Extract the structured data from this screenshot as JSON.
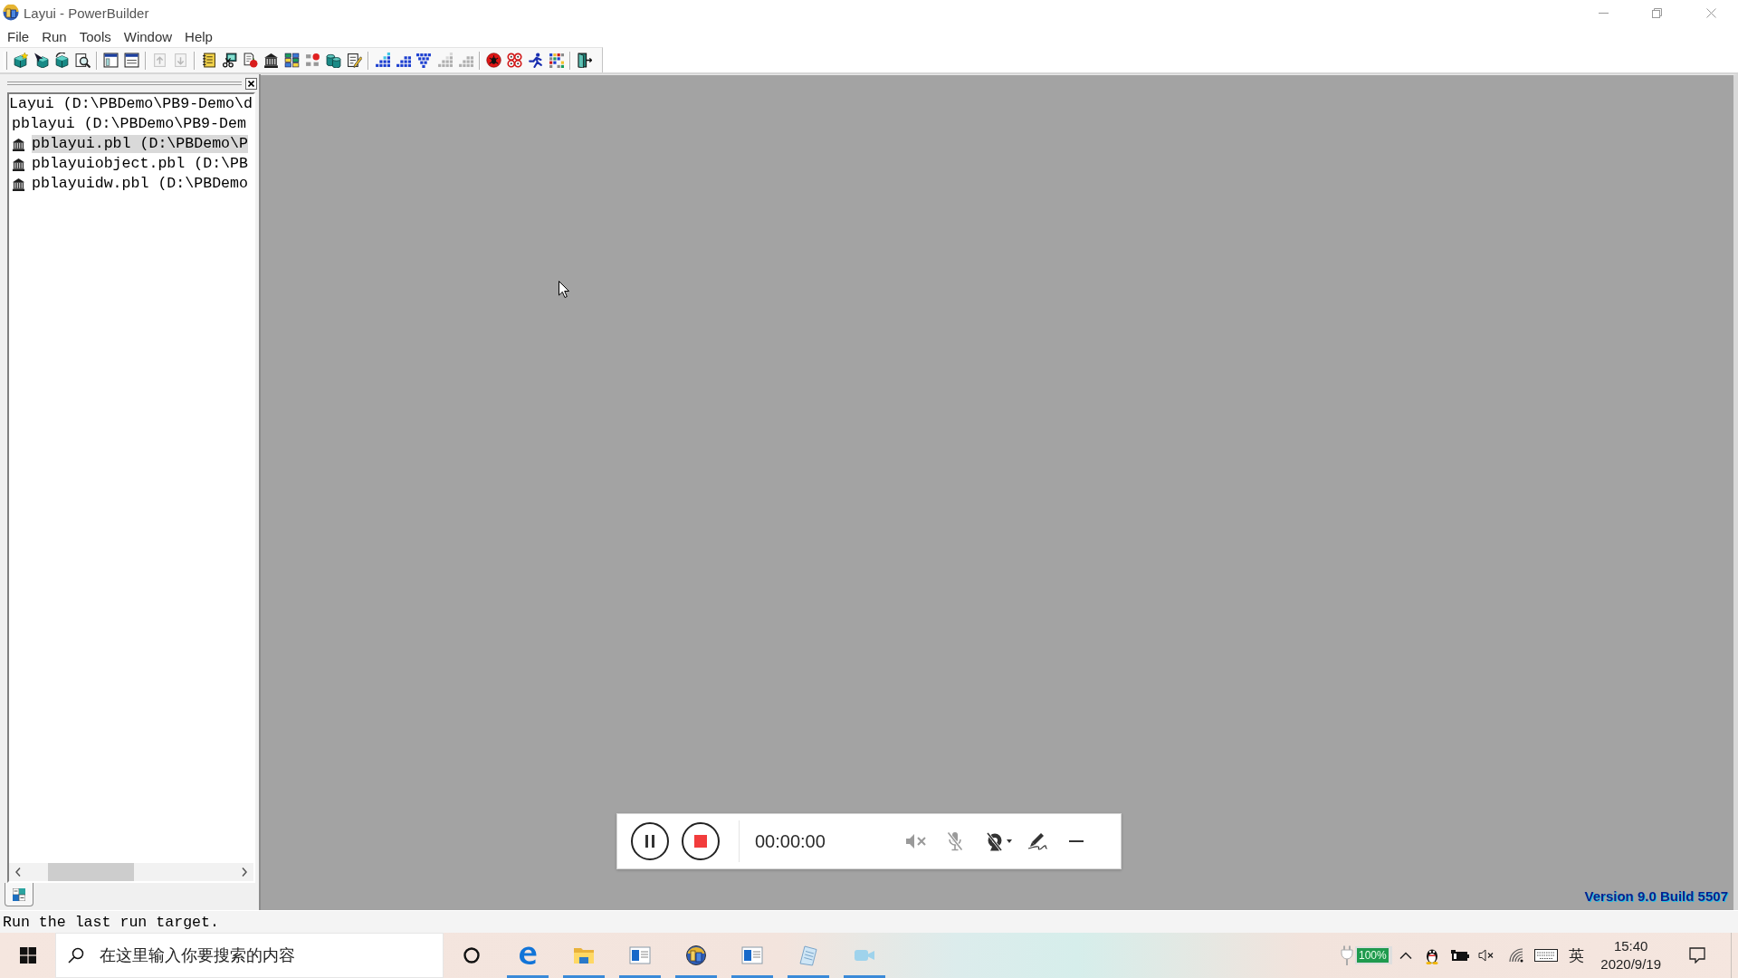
{
  "window": {
    "title": "Layui - PowerBuilder"
  },
  "menu": [
    "File",
    "Run",
    "Tools",
    "Window",
    "Help"
  ],
  "toolbar": [
    [
      {
        "kind": "cubestar",
        "disabled": false
      },
      {
        "kind": "cubearrow",
        "disabled": false
      },
      {
        "kind": "cube",
        "disabled": false
      },
      {
        "kind": "magnifier",
        "disabled": false
      }
    ],
    [
      {
        "kind": "panes",
        "disabled": false
      },
      {
        "kind": "lines",
        "disabled": false
      }
    ],
    [
      {
        "kind": "docup",
        "disabled": true
      },
      {
        "kind": "docdown",
        "disabled": true
      }
    ],
    [
      {
        "kind": "notebook",
        "disabled": false
      },
      {
        "kind": "monitor",
        "disabled": false
      },
      {
        "kind": "document",
        "disabled": false
      },
      {
        "kind": "building",
        "disabled": false
      },
      {
        "kind": "blocks",
        "disabled": false
      },
      {
        "kind": "dots",
        "disabled": false
      },
      {
        "kind": "database",
        "disabled": false
      },
      {
        "kind": "edit",
        "disabled": false
      }
    ],
    [
      {
        "kind": "stairs",
        "disabled": false
      },
      {
        "kind": "steps",
        "disabled": false
      },
      {
        "kind": "funnel",
        "disabled": false
      },
      {
        "kind": "stairs",
        "disabled": true
      },
      {
        "kind": "steps",
        "disabled": true
      }
    ],
    [
      {
        "kind": "bug",
        "disabled": false
      },
      {
        "kind": "circles",
        "disabled": false
      },
      {
        "kind": "runner",
        "disabled": false
      },
      {
        "kind": "mosaic",
        "disabled": false
      }
    ],
    [
      {
        "kind": "door",
        "disabled": false
      }
    ]
  ],
  "workspace": {
    "items": [
      {
        "kind": "workspace",
        "label": "Layui (D:\\PBDemo\\PB9-Demo\\d",
        "selected": false
      },
      {
        "kind": "target",
        "label": "pblayui (D:\\PBDemo\\PB9-Dem",
        "selected": false
      },
      {
        "kind": "library",
        "label": "pblayui.pbl (D:\\PBDemo\\P",
        "selected": true
      },
      {
        "kind": "library",
        "label": "pblayuiobject.pbl (D:\\PB",
        "selected": false
      },
      {
        "kind": "library",
        "label": "pblayuidw.pbl (D:\\PBDemo",
        "selected": false
      }
    ]
  },
  "recorder": {
    "time": "00:00:00"
  },
  "version": "Version 9.0 Build 5507",
  "status_bar": {
    "text": "Run the last run target."
  },
  "taskbar": {
    "search": {
      "placeholder": "在这里输入你要搜索的内容"
    },
    "apps": [
      {
        "kind": "edge",
        "running": true
      },
      {
        "kind": "folder",
        "running": true
      },
      {
        "kind": "window",
        "running": true
      },
      {
        "kind": "sphere",
        "running": true
      },
      {
        "kind": "window",
        "running": true
      },
      {
        "kind": "notepad",
        "running": true
      },
      {
        "kind": "camera",
        "running": true
      }
    ],
    "tray": {
      "battery": "100%",
      "input_method": "英",
      "time": "15:40",
      "date": "2020/9/19"
    }
  }
}
